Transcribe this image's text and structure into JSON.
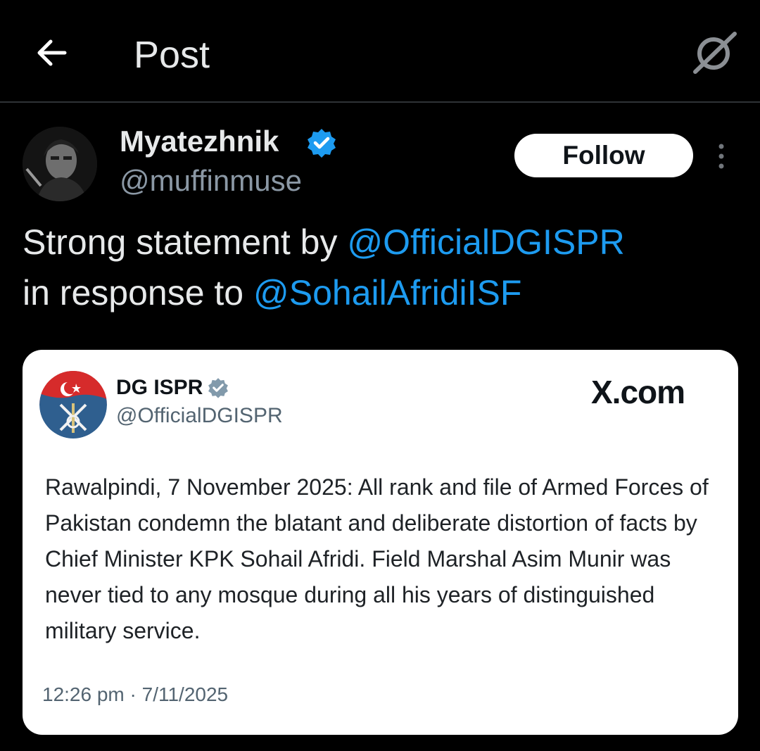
{
  "header": {
    "title": "Post"
  },
  "post": {
    "author_name": "Myatezhnik",
    "author_handle": "@muffinmuse",
    "follow_label": "Follow",
    "text_before": "Strong statement by ",
    "mention_1": "@OfficialDGISPR",
    "text_middle": " in response to ",
    "mention_2": "@SohailAfridiISF"
  },
  "embed": {
    "name": "DG ISPR",
    "handle": "@OfficialDGISPR",
    "source": "X.com",
    "body": "Rawalpindi, 7 November 2025: All rank and file of Armed Forces of Pakistan condemn the blatant and deliberate distortion of facts by Chief Minister KPK Sohail Afridi. Field Marshal Asim Munir was never tied to any mosque during all his years of distinguished military service.",
    "timestamp": "12:26 pm · 7/11/2025"
  },
  "colors": {
    "background": "#000000",
    "mention": "#1d9bf0",
    "verified": "#1d9bf0",
    "embed_verified": "#829aab"
  },
  "icons": {
    "back": "arrow-left-icon",
    "grok": "grok-icon",
    "verified": "verified-badge-icon",
    "more": "more-vertical-icon"
  }
}
